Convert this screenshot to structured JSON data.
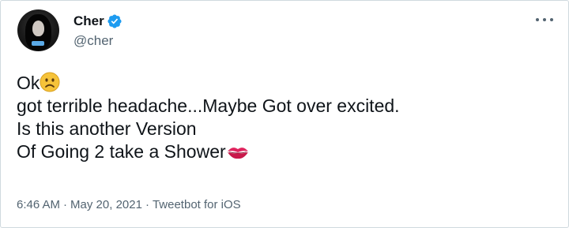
{
  "author": {
    "name": "Cher",
    "handle": "@cher",
    "verified_icon": "verified-badge-icon",
    "verified_color": "#1d9bf0"
  },
  "menu": {
    "icon": "more-options-icon"
  },
  "tweet": {
    "line1_text": "Ok",
    "line1_emoji": "frowning-face-emoji",
    "line2": "got terrible headache...Maybe Got over excited.",
    "line3": "Is this another Version",
    "line4_text": "Of Going 2 take a Shower",
    "line4_emoji": "kiss-mark-emoji"
  },
  "meta": {
    "time": "6:46 AM",
    "separator": "·",
    "date": "May 20, 2021",
    "source": "Tweetbot for iOS"
  },
  "colors": {
    "text": "#0f1419",
    "secondary": "#536471",
    "border": "#cfd9de"
  }
}
